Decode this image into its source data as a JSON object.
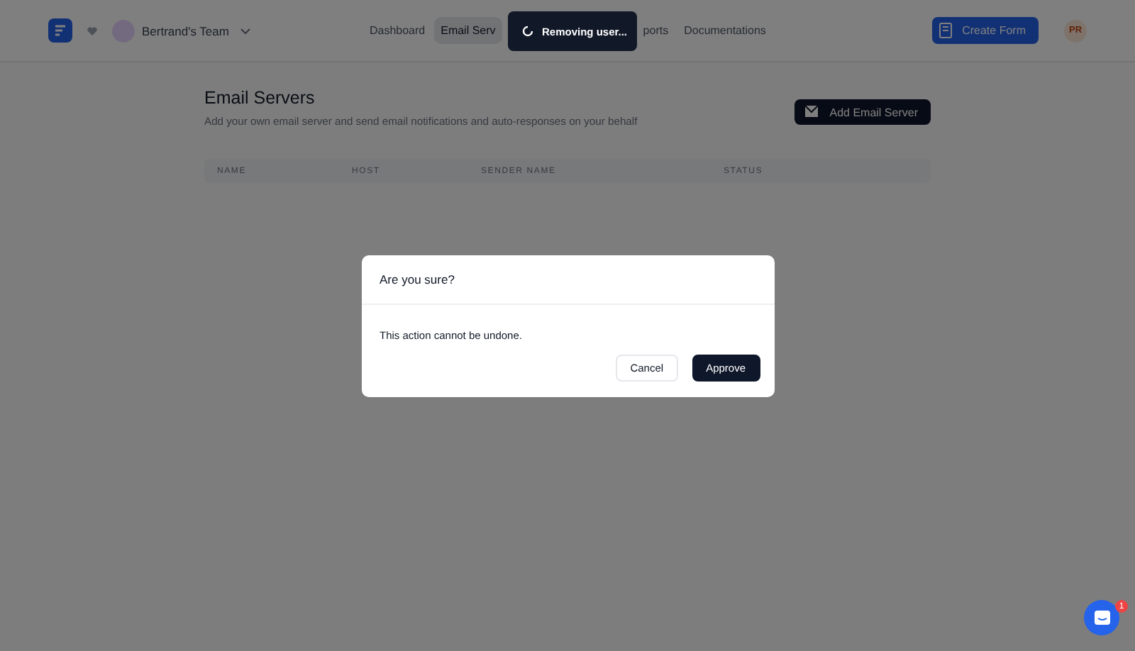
{
  "header": {
    "team": "Bertrand's Team",
    "nav": [
      {
        "label": "Dashboard",
        "selected": false
      },
      {
        "label": "Email Serv",
        "selected": true
      },
      {
        "label": "ports",
        "selected": false
      },
      {
        "label": "Documentations",
        "selected": false
      }
    ],
    "create_button": "Create Form",
    "avatar": "PR"
  },
  "page": {
    "title": "Email Servers",
    "subtitle": "Add your own email server and send email notifications and auto-responses on your behalf",
    "add_button": "Add Email Server"
  },
  "table": {
    "columns": [
      "NAME",
      "HOST",
      "SENDER NAME",
      "STATUS"
    ]
  },
  "toast": {
    "message": "Removing user..."
  },
  "dialog": {
    "title": "Are you sure?",
    "body": "This action cannot be undone.",
    "buttons": [
      {
        "label": "Cancel",
        "kind": "secondary"
      },
      {
        "label": "Approve",
        "kind": "primary"
      }
    ]
  },
  "chat": {
    "badge": "1"
  }
}
